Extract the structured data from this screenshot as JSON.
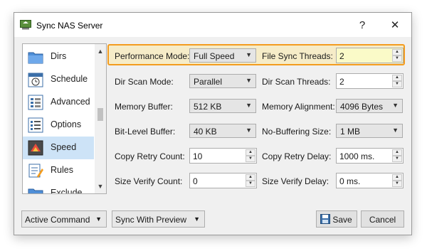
{
  "window": {
    "title": "Sync NAS Server",
    "help_glyph": "?",
    "close_glyph": "✕"
  },
  "sidebar": {
    "items": [
      {
        "label": "Dirs",
        "icon": "folder-icon"
      },
      {
        "label": "Schedule",
        "icon": "schedule-icon"
      },
      {
        "label": "Advanced",
        "icon": "advanced-icon"
      },
      {
        "label": "Options",
        "icon": "options-icon"
      },
      {
        "label": "Speed",
        "icon": "speed-icon",
        "selected": true
      },
      {
        "label": "Rules",
        "icon": "rules-icon"
      },
      {
        "label": "Exclude",
        "icon": "exclude-icon"
      }
    ],
    "scroll_up": "▲",
    "scroll_down": "▼"
  },
  "settings": {
    "performance_mode": {
      "label": "Performance Mode:",
      "value": "Full Speed"
    },
    "file_sync_threads": {
      "label": "File Sync Threads:",
      "value": "2"
    },
    "dir_scan_mode": {
      "label": "Dir Scan Mode:",
      "value": "Parallel"
    },
    "dir_scan_threads": {
      "label": "Dir Scan Threads:",
      "value": "2"
    },
    "memory_buffer": {
      "label": "Memory Buffer:",
      "value": "512 KB"
    },
    "memory_alignment": {
      "label": "Memory Alignment:",
      "value": "4096 Bytes"
    },
    "bit_level_buffer": {
      "label": "Bit-Level Buffer:",
      "value": "40 KB"
    },
    "no_buffering_size": {
      "label": "No-Buffering Size:",
      "value": "1 MB"
    },
    "copy_retry_count": {
      "label": "Copy Retry Count:",
      "value": "10"
    },
    "copy_retry_delay": {
      "label": "Copy Retry Delay:",
      "value": "1000 ms."
    },
    "size_verify_count": {
      "label": "Size Verify Count:",
      "value": "0"
    },
    "size_verify_delay": {
      "label": "Size Verify Delay:",
      "value": "0 ms."
    }
  },
  "footer": {
    "active_command": "Active Command",
    "sync_mode": "Sync With Preview",
    "save_label": "Save",
    "cancel_label": "Cancel"
  },
  "colors": {
    "highlight_border": "#f39c1f",
    "selected_item": "#cde3f7"
  },
  "glyphs": {
    "dropdown": "▼",
    "spin_up": "▲",
    "spin_down": "▼"
  }
}
